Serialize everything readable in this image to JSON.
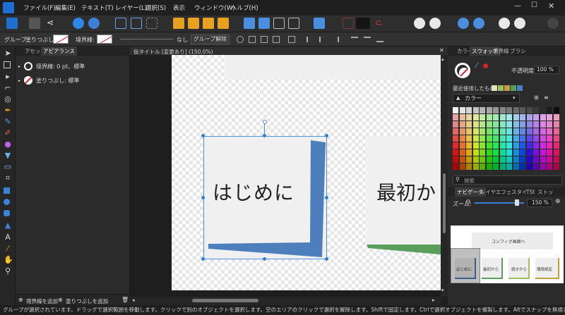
{
  "menu": [
    "ファイル(F)",
    "編集(E)",
    "テキスト(T)",
    "レイヤー(L)",
    "選択(S)",
    "表示",
    "ウィンドウ(W)",
    "ヘルプ(H)"
  ],
  "context_bar": {
    "group_label": "グループ",
    "fill_label": "塗りつぶし:",
    "stroke_label": "境界線:",
    "none_label": "なし",
    "ungroup_label": "グループ解除"
  },
  "left_panel": {
    "tabs": [
      "アセット",
      "アピアランス"
    ],
    "stroke_item": "境界線: 0 pt、標準",
    "fill_item": "塗りつぶし: 標準",
    "add_stroke": "境界線を追加",
    "add_fill": "塗りつぶしを追加"
  },
  "document": {
    "title": "仮タイトル [変更あり] (150.0%)"
  },
  "canvas": {
    "card1_text": "はじめに",
    "card2_text": "最初か"
  },
  "colors": {
    "blue_shape": "#4e7fbd",
    "green_shape": "#5a9e5e",
    "accent": "#2d7fe0"
  },
  "right_panel": {
    "top_tabs": [
      "カラー",
      "スウォッチ",
      "境界線",
      "ブラシ"
    ],
    "opacity_label": "不透明度:",
    "opacity_value": "100 %",
    "recent_label": "最近使用したもの:",
    "palette_name": "カラー",
    "search_placeholder": "検索",
    "bottom_tabs": [
      "ナビゲータ",
      "レイヤ",
      "エフェ",
      "スタイ",
      "TSt",
      "ストッ"
    ],
    "zoom_label": "ズーム:",
    "zoom_value": "150 %",
    "nav_title": "コンフィグ画面へ",
    "nav_labels": [
      "はじめに",
      "最初から",
      "続きから",
      "環境設定"
    ]
  },
  "status": "グループが選択されています。ドラッグで選択範囲を移動します。クリックで別のオブジェクトを選択します。空のエリアのクリックで選択を解除します。Shiftで固定します。Ctrlで選択オブジェクトを複製します。Altでスナップを無視します。"
}
